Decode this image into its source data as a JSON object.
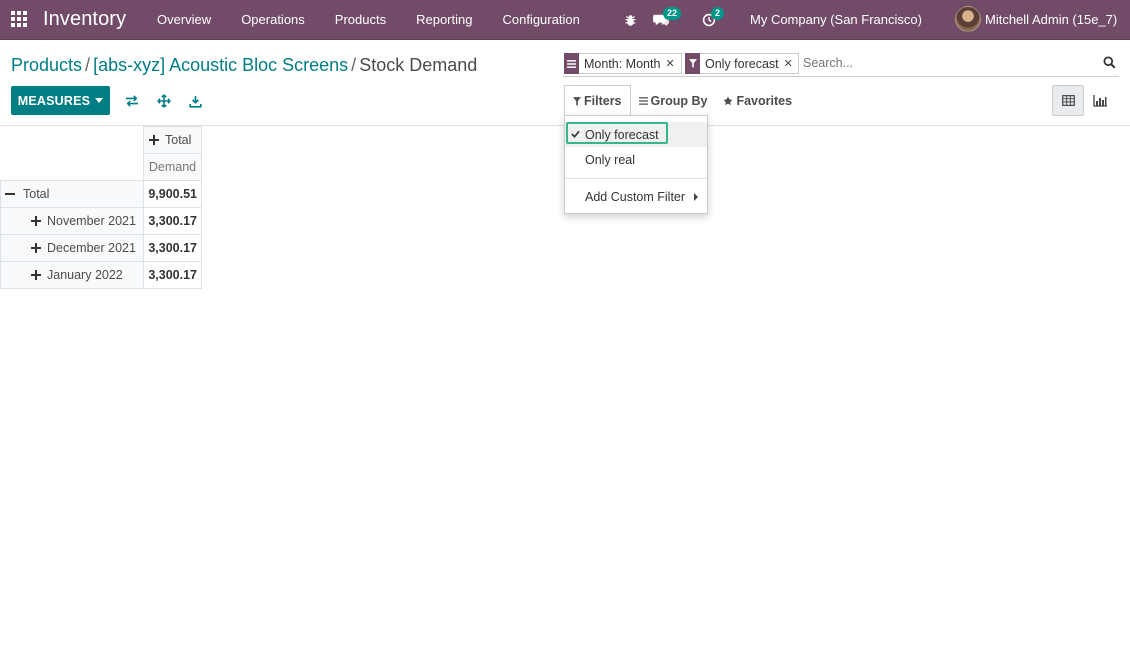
{
  "navbar": {
    "app_name": "Inventory",
    "menu": [
      "Overview",
      "Operations",
      "Products",
      "Reporting",
      "Configuration"
    ],
    "messages_badge": "22",
    "activities_badge": "2",
    "company": "My Company (San Francisco)",
    "user": "Mitchell Admin (15e_7)"
  },
  "breadcrumb": {
    "items": [
      "Products",
      "[abs-xyz] Acoustic Bloc Screens"
    ],
    "separator": "/",
    "current": "Stock Demand"
  },
  "toolbar": {
    "measures_label": "MEASURES"
  },
  "search": {
    "facets": [
      {
        "icon": "group-by-icon",
        "label": "Month: Month"
      },
      {
        "icon": "filter-icon",
        "label": "Only forecast"
      }
    ],
    "placeholder": "Search..."
  },
  "filter_bar": {
    "filters_label": "Filters",
    "group_by_label": "Group By",
    "favorites_label": "Favorites"
  },
  "filters_dropdown": {
    "items": [
      {
        "label": "Only forecast",
        "checked": true
      },
      {
        "label": "Only real",
        "checked": false
      }
    ],
    "custom_filter_label": "Add Custom Filter"
  },
  "pivot": {
    "col_header": "Total",
    "measure": "Demand",
    "total_label": "Total",
    "total_value": "9,900.51",
    "rows": [
      {
        "label": "November 2021",
        "value": "3,300.17"
      },
      {
        "label": "December 2021",
        "value": "3,300.17"
      },
      {
        "label": "January 2022",
        "value": "3,300.17"
      }
    ]
  },
  "colors": {
    "navbar": "#714B67",
    "primary": "#017e84",
    "focus": "#34b789"
  }
}
